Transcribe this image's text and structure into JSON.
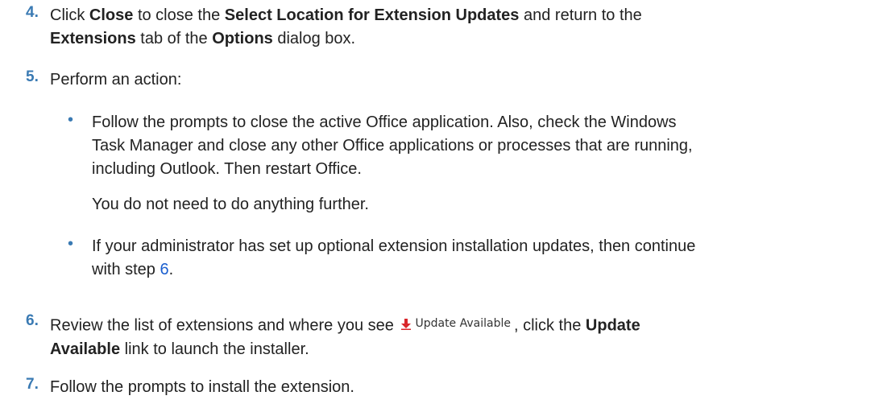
{
  "steps": [
    {
      "number": "4.",
      "intro": "Click",
      "close_label": "Close",
      "mid1": "to close the",
      "dialog_name": "Select Location for Extension Updates",
      "mid2": "and return to the",
      "tab_name": "Extensions",
      "mid3": "tab of the",
      "options_name": "Options",
      "end": "dialog box."
    },
    {
      "number": "5.",
      "text": "Perform an action:",
      "bullets": [
        {
          "line1": "Follow the prompts to close the active Office application. Also, check the Windows",
          "line2": "Task Manager and close any other Office applications or processes that are running,",
          "line3": "including Outlook. Then restart Office.",
          "followup": "You do not need to do anything further."
        },
        {
          "line1": "If your administrator has set up optional extension installation updates, then continue",
          "line2_pre": "with step",
          "link": "6",
          "line2_post": "."
        }
      ]
    },
    {
      "number": "6.",
      "pre": "Review the list of extensions and where you see",
      "badge_label": "Update Available",
      "badge_icon": "download-arrow-icon",
      "mid": ", click the",
      "link_bold_1": "Update",
      "link_bold_2": "Available",
      "end": "link to launch the installer."
    },
    {
      "number": "7.",
      "text": "Follow the prompts to install the extension."
    }
  ],
  "bullet_char": "•",
  "colors": {
    "step_number": "#3a7ab3",
    "link": "#1b5fcf",
    "icon_red": "#d9262b",
    "text": "#222222"
  }
}
